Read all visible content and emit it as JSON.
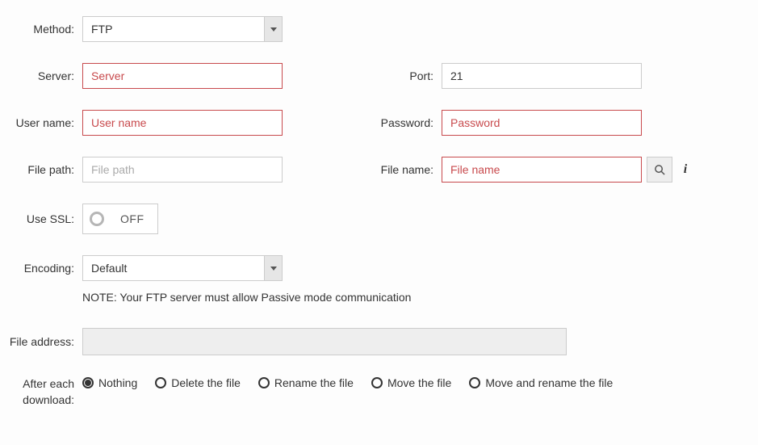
{
  "labels": {
    "method": "Method:",
    "server": "Server:",
    "port": "Port:",
    "username": "User name:",
    "password": "Password:",
    "filepath": "File path:",
    "filename": "File name:",
    "usessl": "Use SSL:",
    "encoding": "Encoding:",
    "fileaddress": "File address:",
    "afterdownload_l1": "After each",
    "afterdownload_l2": "download:"
  },
  "method": {
    "selected": "FTP"
  },
  "server": {
    "placeholder": "Server",
    "value": ""
  },
  "port": {
    "value": "21"
  },
  "username": {
    "placeholder": "User name",
    "value": ""
  },
  "password": {
    "placeholder": "Password",
    "value": ""
  },
  "filepath": {
    "placeholder": "File path",
    "value": ""
  },
  "filename": {
    "placeholder": "File name",
    "value": ""
  },
  "ssl": {
    "label": "OFF",
    "value": false
  },
  "encoding": {
    "selected": "Default"
  },
  "note": "NOTE: Your FTP server must allow Passive mode communication",
  "fileaddress": {
    "value": ""
  },
  "after_download": {
    "options": [
      {
        "label": "Nothing",
        "selected": true
      },
      {
        "label": "Delete the file",
        "selected": false
      },
      {
        "label": "Rename the file",
        "selected": false
      },
      {
        "label": "Move the file",
        "selected": false
      },
      {
        "label": "Move and rename the file",
        "selected": false
      }
    ]
  },
  "icons": {
    "info": "i"
  }
}
